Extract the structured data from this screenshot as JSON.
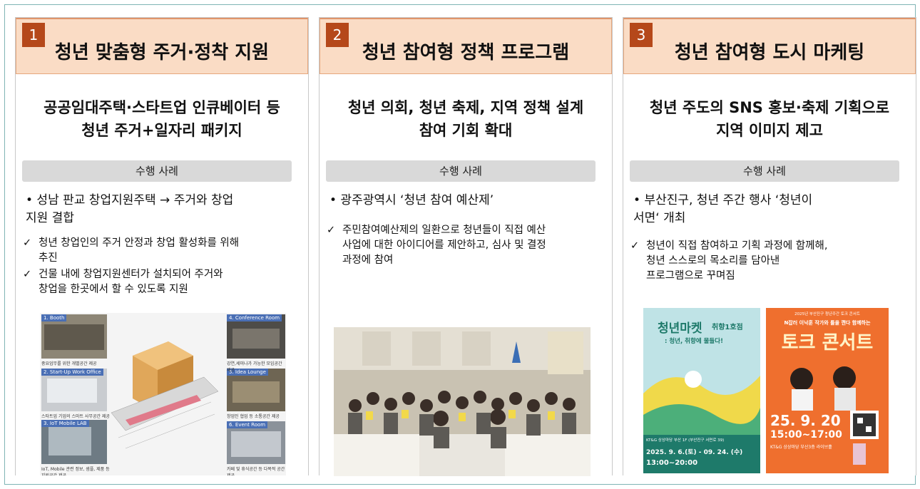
{
  "columns": [
    {
      "number": "1",
      "title": "청년 맞춤형 주거·정착 지원",
      "subtitle": "공공임대주택·스타트업 인큐베이터 등\n청년 주거+일자리 패키지",
      "section_label": "수행 사례",
      "bullet": "• 성남 판교 창업지원주택 → 주거와 창업\n  지원 결합",
      "checks": [
        "청년 창업인의 주거 안정과 창업 활성화를 위해\n추진",
        "건물 내에 창업지원센터가 설치되어 주거와\n창업을 한곳에서 할 수 있도록 지원"
      ],
      "figure": {
        "labels": [
          "1. Booth",
          "2. Start-Up Work Office",
          "3. IoT Mobile LAB",
          "4. Conference Room",
          "5. Idea Lounge",
          "6. Event Room"
        ],
        "captions": [
          "중요업무를 위한 개별공간 제공",
          "스타트업 기업의 스마트 사무공간 제공",
          "IoT, Mobile 관련 정보, 샘플, 제품 등\n지원공간 제공",
          "강연,세미나가 가능한 모임공간 제공",
          "창업인 협업 등 소통공간 제공",
          "카페 및 휴식공간 등 다목적 공간 제공"
        ]
      }
    },
    {
      "number": "2",
      "title": "청년 참여형 정책 프로그램",
      "subtitle": "청년 의회, 청년 축제, 지역 정책 설계\n참여 기회 확대",
      "section_label": "수행 사례",
      "bullet": "• 광주광역시 ‘청년 참여 예산제’",
      "checks": [
        "주민참여예산제의 일환으로 청년들이 직접 예산\n사업에 대한 아이디어를 제안하고, 심사 및 결정\n과정에 참여"
      ]
    },
    {
      "number": "3",
      "title": "청년 참여형 도시 마케팅",
      "subtitle": "청년 주도의 SNS 홍보·축제 기획으로\n지역 이미지 제고",
      "section_label": "수행 사례",
      "bullet": "• 부산진구, 청년 주간 행사 ‘청년이\n  서면‘ 개최",
      "checks": [
        "청년이 직접 참여하고 기획 과정에 함께해,\n청년 스스로의 목소리를 담아낸\n프로그램으로 꾸며짐"
      ],
      "poster1": {
        "title": "청년마켓",
        "tag": "취향1호점",
        "subtitle": ": 청년, 취향에 물들다!",
        "venue": "KT&G 상상마당 부산 1F (부산진구 서면로 39)",
        "date": "2025. 9. 6.(토) - 09. 24. (수)",
        "time": "13:00~20:00"
      },
      "poster2": {
        "header": "2025년 부산진구 청년주간 토크 콘서트",
        "tagline": "N잡러 이낙훈 작가와 틀을 깬다 함께하는",
        "title": "토크 콘서트",
        "date": "25. 9. 20",
        "time": "15:00~17:00",
        "venue": "KT&G 상상마당 부산3층 라이브홀"
      }
    }
  ]
}
